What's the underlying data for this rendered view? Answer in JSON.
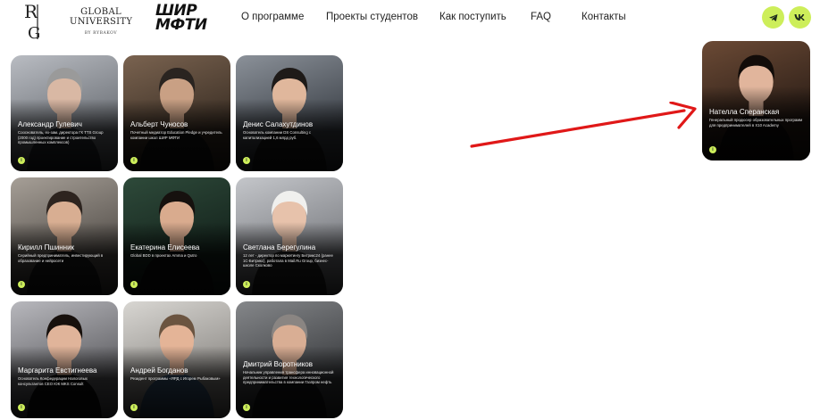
{
  "header": {
    "logo_monogram": "RIG",
    "logo_university_line1": "GLOBAL",
    "logo_university_line2": "UNIVERSITY",
    "logo_university_sub": "BY RYBAKOV",
    "logo_shir_line1": "ШИР",
    "logo_shir_line2": "МФТИ",
    "nav": [
      {
        "label": "О программе"
      },
      {
        "label": "Проекты студентов"
      },
      {
        "label": "Как поступить"
      },
      {
        "label": "FAQ"
      },
      {
        "label": "Контакты"
      }
    ],
    "social": [
      {
        "icon": "telegram-icon"
      },
      {
        "icon": "vk-icon"
      }
    ]
  },
  "accent_color": "#cdee5a",
  "arrow_color": "#e01818",
  "speakers": [
    {
      "name": "Александр Гулевич",
      "desc": "Сооснователь, ex-зам. директора ГК TTS Group (2000 год) проектирование и строительство промышленных комплексов)",
      "bg": "#6b6f75",
      "bg2": "#b9bcc2",
      "skin": "#d9b8a4",
      "hair": "#9a9a9a",
      "suit": "#2b2f36",
      "badge": "i"
    },
    {
      "name": "Альберт Чуносов",
      "desc": "Почетный медиатор Education Pledge и учредитель компании школ ШИР МФТИ",
      "bg": "#3a2e24",
      "bg2": "#7a6350",
      "skin": "#c9a084",
      "hair": "#2a2420",
      "suit": "#151515",
      "badge": "i"
    },
    {
      "name": "Денис Салахутдинов",
      "desc": "Основатель компании DS Consulting с капитализацией 1,6 млрд руб.",
      "bg": "#3c4148",
      "bg2": "#8b9199",
      "skin": "#e0b79c",
      "hair": "#1e1a18",
      "suit": "#1c1c1c",
      "badge": "i"
    },
    {
      "name": "Кирилл Пшинник",
      "desc": "Серийный предприниматель, инвестирующий в образование и нейросети",
      "bg": "#55504b",
      "bg2": "#a69f97",
      "skin": "#d8ae92",
      "hair": "#2d241f",
      "suit": "#1e1e1e",
      "badge": "i"
    },
    {
      "name": "Екатерина Елисеева",
      "desc": "Global BDD в проектах Amma и Qutro",
      "bg": "#14231c",
      "bg2": "#2e4a3a",
      "skin": "#d9ab8e",
      "hair": "#16110e",
      "suit": "#0f0f0f",
      "badge": "i"
    },
    {
      "name": "Светлана Берегулина",
      "desc": "12 лет - директор по маркетингу Битрикс24 (ранее 1С-Битрикс), работала в Mail.Ru Group, бизнес-школе Сколково",
      "bg": "#7b7d82",
      "bg2": "#c4c6ca",
      "skin": "#e7c2ab",
      "hair": "#f0f0ee",
      "suit": "#262626",
      "badge": "i"
    },
    {
      "name": "Маргарита Евстигнеева",
      "desc": "Основатель Конфедерации Налоговых консультантов CEO ЮК MKS Consult",
      "bg": "#5f5f63",
      "bg2": "#b8b8bd",
      "skin": "#e0b49a",
      "hair": "#17100c",
      "suit": "#0e0e0e",
      "badge": "i"
    },
    {
      "name": "Андрей Богданов",
      "desc": "Резидент программы «ЯРД с Игорем Рыбаковым»",
      "bg": "#8d8a86",
      "bg2": "#d8d6d2",
      "skin": "#e4b497",
      "hair": "#6b5440",
      "suit": "#3b5877",
      "badge": "i"
    },
    {
      "name": "Дмитрий Воротников",
      "desc": "Начальник управления трансфера инновационной деятельности и развития технологического предпринимательства в компании Газпром нефть",
      "bg": "#3b3d40",
      "bg2": "#85878a",
      "skin": "#d9ae94",
      "hair": "#8a8582",
      "suit": "#17181a",
      "badge": "i"
    },
    {
      "name": "Нателла Сперанская",
      "desc": "Генеральный продюсер образовательных программ для предпринимателей в X10 Academy",
      "bg": "#2c1e17",
      "bg2": "#6b4a35",
      "skin": "#e1b59c",
      "hair": "#120c09",
      "suit": "#0f0b0a",
      "badge": "i"
    }
  ]
}
